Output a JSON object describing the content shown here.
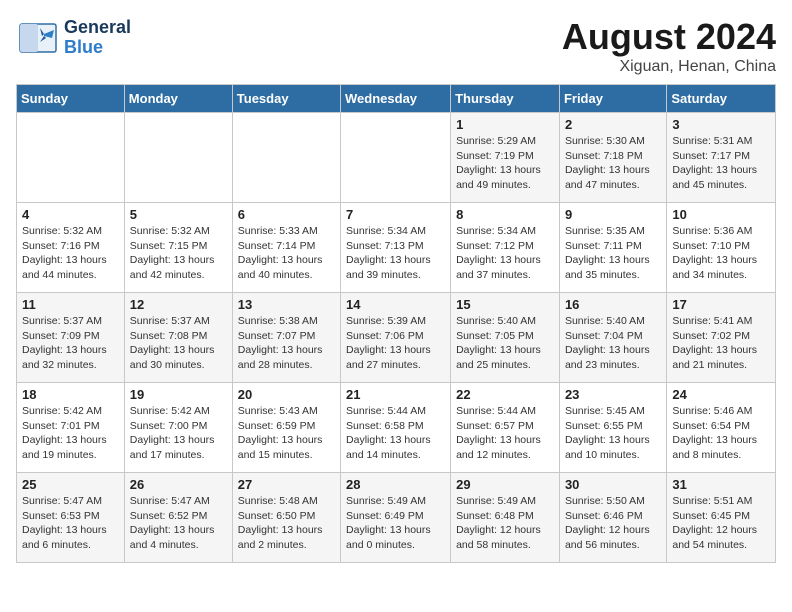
{
  "header": {
    "logo_general": "General",
    "logo_blue": "Blue",
    "main_title": "August 2024",
    "subtitle": "Xiguan, Henan, China"
  },
  "days_of_week": [
    "Sunday",
    "Monday",
    "Tuesday",
    "Wednesday",
    "Thursday",
    "Friday",
    "Saturday"
  ],
  "weeks": [
    [
      {
        "day": "",
        "info": ""
      },
      {
        "day": "",
        "info": ""
      },
      {
        "day": "",
        "info": ""
      },
      {
        "day": "",
        "info": ""
      },
      {
        "day": "1",
        "info": "Sunrise: 5:29 AM\nSunset: 7:19 PM\nDaylight: 13 hours\nand 49 minutes."
      },
      {
        "day": "2",
        "info": "Sunrise: 5:30 AM\nSunset: 7:18 PM\nDaylight: 13 hours\nand 47 minutes."
      },
      {
        "day": "3",
        "info": "Sunrise: 5:31 AM\nSunset: 7:17 PM\nDaylight: 13 hours\nand 45 minutes."
      }
    ],
    [
      {
        "day": "4",
        "info": "Sunrise: 5:32 AM\nSunset: 7:16 PM\nDaylight: 13 hours\nand 44 minutes."
      },
      {
        "day": "5",
        "info": "Sunrise: 5:32 AM\nSunset: 7:15 PM\nDaylight: 13 hours\nand 42 minutes."
      },
      {
        "day": "6",
        "info": "Sunrise: 5:33 AM\nSunset: 7:14 PM\nDaylight: 13 hours\nand 40 minutes."
      },
      {
        "day": "7",
        "info": "Sunrise: 5:34 AM\nSunset: 7:13 PM\nDaylight: 13 hours\nand 39 minutes."
      },
      {
        "day": "8",
        "info": "Sunrise: 5:34 AM\nSunset: 7:12 PM\nDaylight: 13 hours\nand 37 minutes."
      },
      {
        "day": "9",
        "info": "Sunrise: 5:35 AM\nSunset: 7:11 PM\nDaylight: 13 hours\nand 35 minutes."
      },
      {
        "day": "10",
        "info": "Sunrise: 5:36 AM\nSunset: 7:10 PM\nDaylight: 13 hours\nand 34 minutes."
      }
    ],
    [
      {
        "day": "11",
        "info": "Sunrise: 5:37 AM\nSunset: 7:09 PM\nDaylight: 13 hours\nand 32 minutes."
      },
      {
        "day": "12",
        "info": "Sunrise: 5:37 AM\nSunset: 7:08 PM\nDaylight: 13 hours\nand 30 minutes."
      },
      {
        "day": "13",
        "info": "Sunrise: 5:38 AM\nSunset: 7:07 PM\nDaylight: 13 hours\nand 28 minutes."
      },
      {
        "day": "14",
        "info": "Sunrise: 5:39 AM\nSunset: 7:06 PM\nDaylight: 13 hours\nand 27 minutes."
      },
      {
        "day": "15",
        "info": "Sunrise: 5:40 AM\nSunset: 7:05 PM\nDaylight: 13 hours\nand 25 minutes."
      },
      {
        "day": "16",
        "info": "Sunrise: 5:40 AM\nSunset: 7:04 PM\nDaylight: 13 hours\nand 23 minutes."
      },
      {
        "day": "17",
        "info": "Sunrise: 5:41 AM\nSunset: 7:02 PM\nDaylight: 13 hours\nand 21 minutes."
      }
    ],
    [
      {
        "day": "18",
        "info": "Sunrise: 5:42 AM\nSunset: 7:01 PM\nDaylight: 13 hours\nand 19 minutes."
      },
      {
        "day": "19",
        "info": "Sunrise: 5:42 AM\nSunset: 7:00 PM\nDaylight: 13 hours\nand 17 minutes."
      },
      {
        "day": "20",
        "info": "Sunrise: 5:43 AM\nSunset: 6:59 PM\nDaylight: 13 hours\nand 15 minutes."
      },
      {
        "day": "21",
        "info": "Sunrise: 5:44 AM\nSunset: 6:58 PM\nDaylight: 13 hours\nand 14 minutes."
      },
      {
        "day": "22",
        "info": "Sunrise: 5:44 AM\nSunset: 6:57 PM\nDaylight: 13 hours\nand 12 minutes."
      },
      {
        "day": "23",
        "info": "Sunrise: 5:45 AM\nSunset: 6:55 PM\nDaylight: 13 hours\nand 10 minutes."
      },
      {
        "day": "24",
        "info": "Sunrise: 5:46 AM\nSunset: 6:54 PM\nDaylight: 13 hours\nand 8 minutes."
      }
    ],
    [
      {
        "day": "25",
        "info": "Sunrise: 5:47 AM\nSunset: 6:53 PM\nDaylight: 13 hours\nand 6 minutes."
      },
      {
        "day": "26",
        "info": "Sunrise: 5:47 AM\nSunset: 6:52 PM\nDaylight: 13 hours\nand 4 minutes."
      },
      {
        "day": "27",
        "info": "Sunrise: 5:48 AM\nSunset: 6:50 PM\nDaylight: 13 hours\nand 2 minutes."
      },
      {
        "day": "28",
        "info": "Sunrise: 5:49 AM\nSunset: 6:49 PM\nDaylight: 13 hours\nand 0 minutes."
      },
      {
        "day": "29",
        "info": "Sunrise: 5:49 AM\nSunset: 6:48 PM\nDaylight: 12 hours\nand 58 minutes."
      },
      {
        "day": "30",
        "info": "Sunrise: 5:50 AM\nSunset: 6:46 PM\nDaylight: 12 hours\nand 56 minutes."
      },
      {
        "day": "31",
        "info": "Sunrise: 5:51 AM\nSunset: 6:45 PM\nDaylight: 12 hours\nand 54 minutes."
      }
    ]
  ]
}
